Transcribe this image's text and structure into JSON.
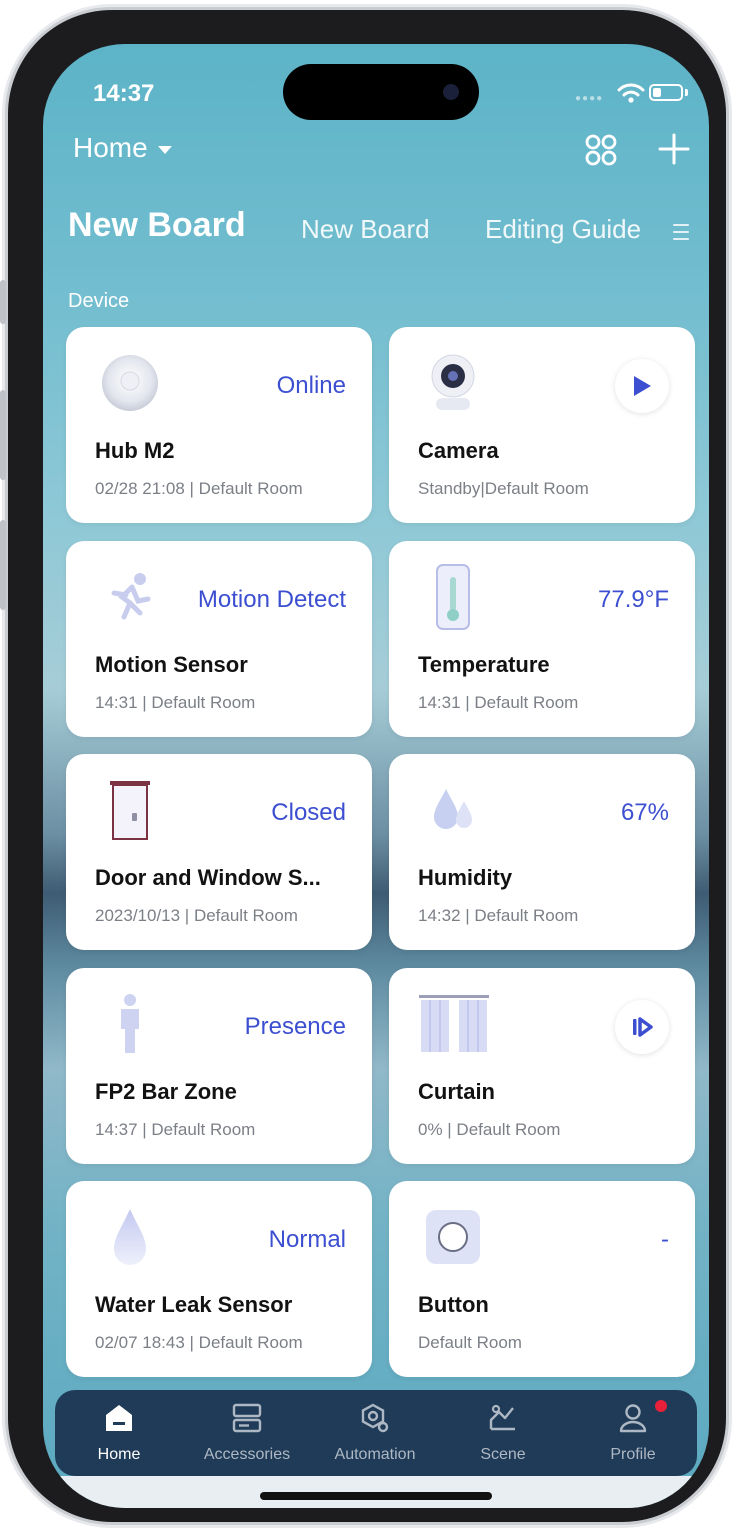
{
  "status_bar": {
    "time": "14:37"
  },
  "header": {
    "home_label": "Home"
  },
  "boards": {
    "active": "New Board",
    "tab2": "New Board",
    "tab3": "Editing Guide"
  },
  "section": {
    "label": "Device"
  },
  "devices": [
    {
      "status": "Online",
      "name": "Hub M2",
      "sub": "02/28 21:08 | Default Room",
      "icon": "hub-icon"
    },
    {
      "status": "",
      "name": "Camera",
      "sub": "Standby|Default Room",
      "icon": "camera-icon"
    },
    {
      "status": "Motion Detect",
      "name": "Motion Sensor",
      "sub": "14:31 | Default Room",
      "icon": "running-person-icon"
    },
    {
      "status": "77.9°F",
      "name": "Temperature",
      "sub": "14:31 | Default Room",
      "icon": "thermometer-icon"
    },
    {
      "status": "Closed",
      "name": "Door and Window S...",
      "sub": "2023/10/13 | Default Room",
      "icon": "door-icon"
    },
    {
      "status": "67%",
      "name": "Humidity",
      "sub": "14:32 | Default Room",
      "icon": "water-drops-icon"
    },
    {
      "status": "Presence",
      "name": "FP2 Bar Zone",
      "sub": "14:37 | Default Room",
      "icon": "person-icon"
    },
    {
      "status": "",
      "name": "Curtain",
      "sub": "0% | Default Room",
      "icon": "curtain-icon"
    },
    {
      "status": "Normal",
      "name": "Water Leak Sensor",
      "sub": "02/07 18:43 | Default Room",
      "icon": "water-drop-icon"
    },
    {
      "status": "-",
      "name": "Button",
      "sub": "Default Room",
      "icon": "wireless-button-icon"
    }
  ],
  "nav": [
    {
      "label": "Home",
      "icon": "home-icon",
      "active": true
    },
    {
      "label": "Accessories",
      "icon": "accessories-icon",
      "active": false
    },
    {
      "label": "Automation",
      "icon": "automation-icon",
      "active": false
    },
    {
      "label": "Scene",
      "icon": "scene-icon",
      "active": false
    },
    {
      "label": "Profile",
      "icon": "profile-icon",
      "active": false
    }
  ],
  "colors": {
    "accent": "#3c4fd1",
    "nav_bg": "#1f3b57",
    "badge": "#e8203a"
  }
}
